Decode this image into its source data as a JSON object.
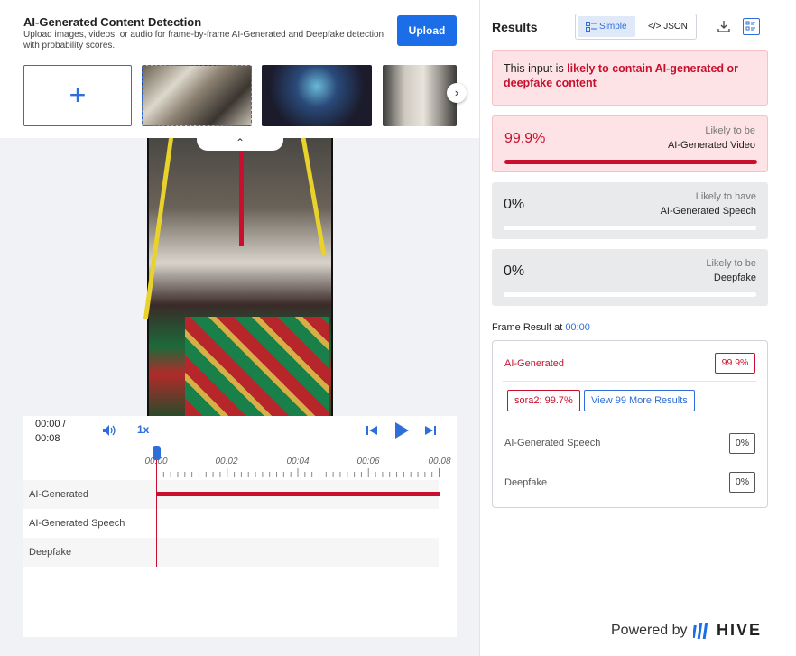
{
  "header": {
    "title": "AI-Generated Content Detection",
    "subtitle": "Upload images, videos, or audio for frame-by-frame AI-Generated and Deepfake detection with probability scores.",
    "upload_label": "Upload"
  },
  "player": {
    "time_current": "00:00 /",
    "time_total": "00:08",
    "speed": "1x",
    "ticks": [
      "00:00",
      "00:02",
      "00:04",
      "00:06",
      "00:08"
    ]
  },
  "tracks": [
    "AI-Generated",
    "AI-Generated Speech",
    "Deepfake"
  ],
  "results": {
    "title": "Results",
    "view_simple": "Simple",
    "view_json": "</> JSON",
    "alert_prefix": "This input is ",
    "alert_emphasis": "likely to contain AI-generated or deepfake content",
    "cards": [
      {
        "pct": "99.9%",
        "line1": "Likely to be",
        "line2": "AI-Generated Video",
        "fill": 1.0
      },
      {
        "pct": "0%",
        "line1": "Likely to have",
        "line2": "AI-Generated Speech",
        "fill": 0
      },
      {
        "pct": "0%",
        "line1": "Likely to be",
        "line2": "Deepfake",
        "fill": 0
      }
    ]
  },
  "frame": {
    "title": "Frame Result at",
    "time": "00:00",
    "ai_label": "AI-Generated",
    "ai_value": "99.9%",
    "chip_model": "sora2: 99.7%",
    "chip_more": "View 99 More Results",
    "speech_label": "AI-Generated Speech",
    "speech_value": "0%",
    "deepfake_label": "Deepfake",
    "deepfake_value": "0%"
  },
  "footer": {
    "powered_by": "Powered by",
    "brand": "HIVE"
  },
  "colors": {
    "accent": "#2f6ed8",
    "danger": "#c8102e",
    "alert_bg": "#fde3e6"
  }
}
